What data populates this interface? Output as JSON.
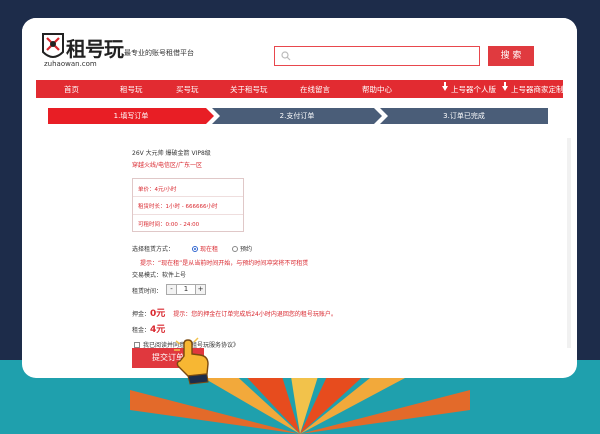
{
  "header": {
    "logo_text": "租号玩",
    "logo_sub": "zuhaowan.com",
    "tagline": "最专业的账号租借平台",
    "search_placeholder": "",
    "search_button": "搜 索"
  },
  "nav": {
    "items": [
      "首页",
      "租号玩",
      "买号玩",
      "关于租号玩",
      "在线留言",
      "帮助中心"
    ],
    "downloads": [
      "上号器个人版",
      "上号器商家定制版"
    ]
  },
  "steps": [
    "1.填写订单",
    "2.支付订单",
    "3.订单已完成"
  ],
  "order": {
    "product_title": "26V 大元帅 爆破金箭 VIP8级",
    "region": "穿越火线/电信区/广东一区",
    "price_label": "单价：4元/小时",
    "duration_label": "租赁时长：1小时 - 666666小时",
    "time_label": "可租时间：0:00 - 24:00",
    "rent_method_label": "选择租赁方式：",
    "rent_option_now": "现在租",
    "rent_option_reserve": "预约",
    "tip_rent": "提示：“现在租”是从当前时间开始，与预约时间冲突将不可租赁",
    "trade_mode": "交易模式：软件上号",
    "hours_label": "租赁时间：",
    "hours_minus": "-",
    "hours_value": "1",
    "hours_plus": "+",
    "deposit_label": "押金：",
    "deposit_value": "0元",
    "deposit_tip": "提示：您的押金在订单完成后24小时内退回您的租号玩账户。",
    "rent_label": "租金：",
    "rent_value": "4元",
    "agreement_text": "我已阅读并同意《租号玩服务协议》",
    "submit_button": "提交订单"
  },
  "colors": {
    "brand_red": "#e22b31",
    "step_inactive": "#4a5d78",
    "frame_navy": "#1d2c4a",
    "frame_teal": "#1fa0ad"
  }
}
